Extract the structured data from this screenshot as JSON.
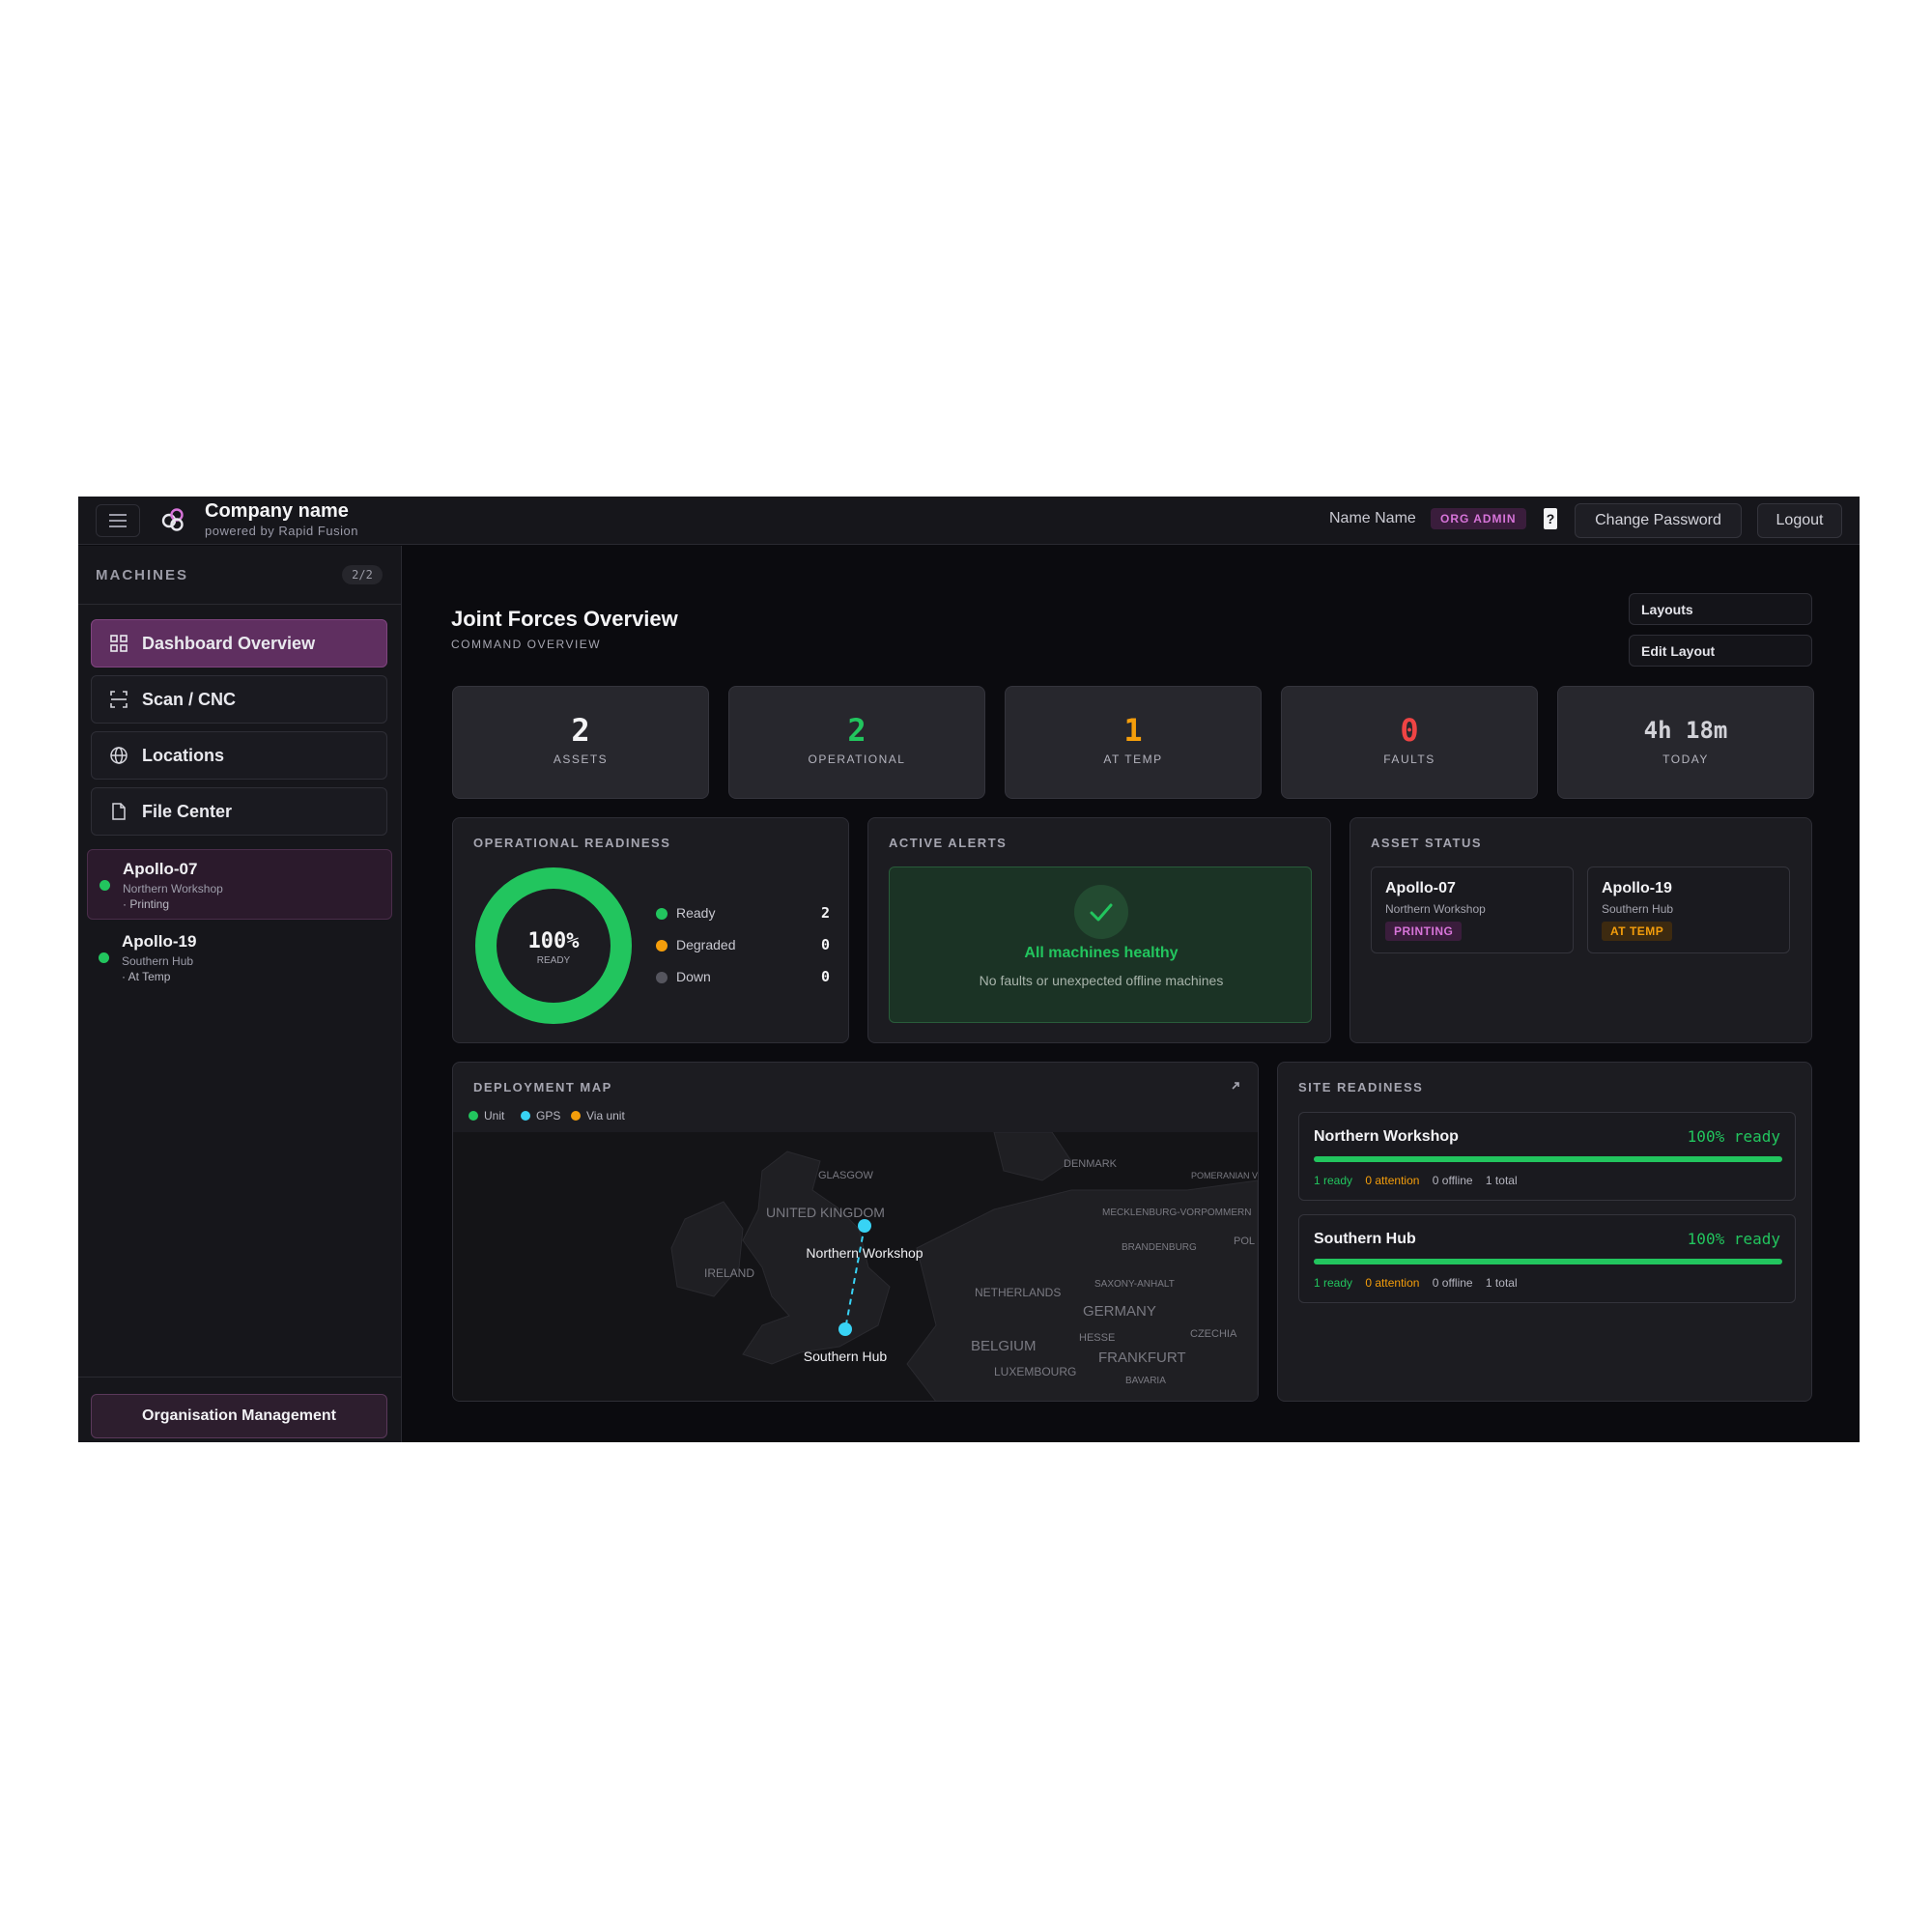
{
  "header": {
    "company": "Company name",
    "powered_by": "powered by Rapid Fusion",
    "user_name": "Name Name",
    "role": "ORG ADMIN",
    "help": "?",
    "change_password": "Change Password",
    "logout": "Logout"
  },
  "sidebar": {
    "section_title": "MACHINES",
    "count": "2/2",
    "nav": [
      {
        "label": "Dashboard Overview",
        "icon": "grid-icon"
      },
      {
        "label": "Scan / CNC",
        "icon": "scan-icon"
      },
      {
        "label": "Locations",
        "icon": "globe-icon"
      },
      {
        "label": "File Center",
        "icon": "file-icon"
      }
    ],
    "machines": [
      {
        "name": "Apollo-07",
        "location": "Northern Workshop",
        "state": "· Printing"
      },
      {
        "name": "Apollo-19",
        "location": "Southern Hub",
        "state": "· At Temp"
      }
    ],
    "org_management": "Organisation Management"
  },
  "page": {
    "title": "Joint Forces Overview",
    "subtitle": "COMMAND OVERVIEW",
    "layouts_button": "Layouts",
    "edit_layout_button": "Edit Layout"
  },
  "stats": [
    {
      "value": "2",
      "label": "ASSETS",
      "color": "#f4f4f6"
    },
    {
      "value": "2",
      "label": "OPERATIONAL",
      "color": "#22c55e"
    },
    {
      "value": "1",
      "label": "AT TEMP",
      "color": "#f59e0b"
    },
    {
      "value": "0",
      "label": "FAULTS",
      "color": "#ef4444"
    },
    {
      "value": "4h 18m",
      "label": "TODAY",
      "color": "#d2d2d8"
    }
  ],
  "readiness": {
    "title": "OPERATIONAL READINESS",
    "percent_label": "100%",
    "percent": 100,
    "sub": "READY",
    "legend": [
      {
        "label": "Ready",
        "value": "2",
        "color": "#22c55e"
      },
      {
        "label": "Degraded",
        "value": "0",
        "color": "#f59e0b"
      },
      {
        "label": "Down",
        "value": "0",
        "color": "#55555e"
      }
    ]
  },
  "alerts": {
    "title": "ACTIVE ALERTS",
    "status_title": "All machines healthy",
    "status_text": "No faults or unexpected offline machines"
  },
  "asset_status": {
    "title": "ASSET STATUS",
    "assets": [
      {
        "name": "Apollo-07",
        "location": "Northern Workshop",
        "badge": "PRINTING",
        "badge_color": "#d774d9",
        "badge_bg": "#3a1d3c"
      },
      {
        "name": "Apollo-19",
        "location": "Southern Hub",
        "badge": "AT TEMP",
        "badge_color": "#f59e0b",
        "badge_bg": "#3d2a10"
      }
    ]
  },
  "map": {
    "title": "DEPLOYMENT MAP",
    "legend": [
      {
        "label": "Unit",
        "color": "#22c55e"
      },
      {
        "label": "GPS",
        "color": "#38d3f5"
      },
      {
        "label": "Via unit",
        "color": "#f59e0b"
      }
    ],
    "places": [
      "GLASGOW",
      "DENMARK",
      "POMERANIAN VOIVODESHIP",
      "UNITED KINGDOM",
      "MECKLENBURG-VORPOMMERN",
      "POL",
      "BRANDENBURG",
      "IRELAND",
      "NETHERLANDS",
      "SAXONY-ANHALT",
      "GERMANY",
      "CZECHIA",
      "BELGIUM",
      "HESSE",
      "FRANKFURT",
      "LUXEMBOURG",
      "BAVARIA"
    ],
    "markers": [
      {
        "label": "Northern Workshop"
      },
      {
        "label": "Southern Hub"
      }
    ]
  },
  "site_readiness": {
    "title": "SITE READINESS",
    "sites": [
      {
        "name": "Northern Workshop",
        "ready_label": "100% ready",
        "percent": 100,
        "ready": "1 ready",
        "attention": "0 attention",
        "offline": "0 offline",
        "total": "1 total"
      },
      {
        "name": "Southern Hub",
        "ready_label": "100% ready",
        "percent": 100,
        "ready": "1 ready",
        "attention": "0 attention",
        "offline": "0 offline",
        "total": "1 total"
      }
    ]
  }
}
